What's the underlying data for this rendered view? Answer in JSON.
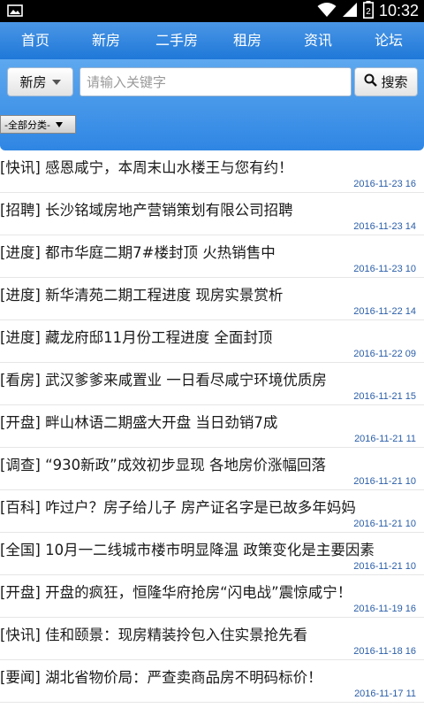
{
  "status_bar": {
    "time": "10:32",
    "battery_level": "2",
    "icons": [
      "image-icon",
      "wifi-icon",
      "signal-icon",
      "battery-icon"
    ]
  },
  "nav": {
    "items": [
      {
        "label": "首页"
      },
      {
        "label": "新房"
      },
      {
        "label": "二手房"
      },
      {
        "label": "租房"
      },
      {
        "label": "资讯"
      },
      {
        "label": "论坛"
      }
    ]
  },
  "search": {
    "category": "新房",
    "placeholder": "请输入关键字",
    "button_label": "搜索"
  },
  "filter": {
    "selected": "-全部分类-"
  },
  "colors": {
    "nav_bg": "#1f78d8",
    "date_text": "#2a5ea8"
  },
  "news": [
    {
      "tag": "[快讯]",
      "title": "感恩咸宁，本周末山水楼王与您有约！",
      "date": "2016-11-23 16"
    },
    {
      "tag": "[招聘]",
      "title": "长沙铭域房地产营销策划有限公司招聘",
      "date": "2016-11-23 14"
    },
    {
      "tag": "[进度]",
      "title": "都市华庭二期7#楼封顶 火热销售中",
      "date": "2016-11-23 10"
    },
    {
      "tag": "[进度]",
      "title": "新华清苑二期工程进度 现房实景赏析",
      "date": "2016-11-22 14"
    },
    {
      "tag": "[进度]",
      "title": "藏龙府邸11月份工程进度 全面封顶",
      "date": "2016-11-22 09"
    },
    {
      "tag": "[看房]",
      "title": "武汉爹爹来咸置业 一日看尽咸宁环境优质房",
      "date": "2016-11-21 15"
    },
    {
      "tag": "[开盘]",
      "title": "畔山林语二期盛大开盘 当日劲销7成",
      "date": "2016-11-21 11"
    },
    {
      "tag": "[调查]",
      "title": "“930新政”成效初步显现 各地房价涨幅回落",
      "date": "2016-11-21 10"
    },
    {
      "tag": "[百科]",
      "title": "咋过户？房子给儿子 房产证名字是已故多年妈妈",
      "date": "2016-11-21 10"
    },
    {
      "tag": "[全国]",
      "title": "10月一二线城市楼市明显降温 政策变化是主要因素",
      "date": "2016-11-21 10"
    },
    {
      "tag": "[开盘]",
      "title": "开盘的疯狂，恒隆华府抢房“闪电战”震惊咸宁！",
      "date": "2016-11-19 16"
    },
    {
      "tag": "[快讯]",
      "title": "佳和颐景：现房精装拎包入住实景抢先看",
      "date": "2016-11-18 16"
    },
    {
      "tag": "[要闻]",
      "title": "湖北省物价局：严查卖商品房不明码标价！",
      "date": "2016-11-17 11"
    }
  ]
}
